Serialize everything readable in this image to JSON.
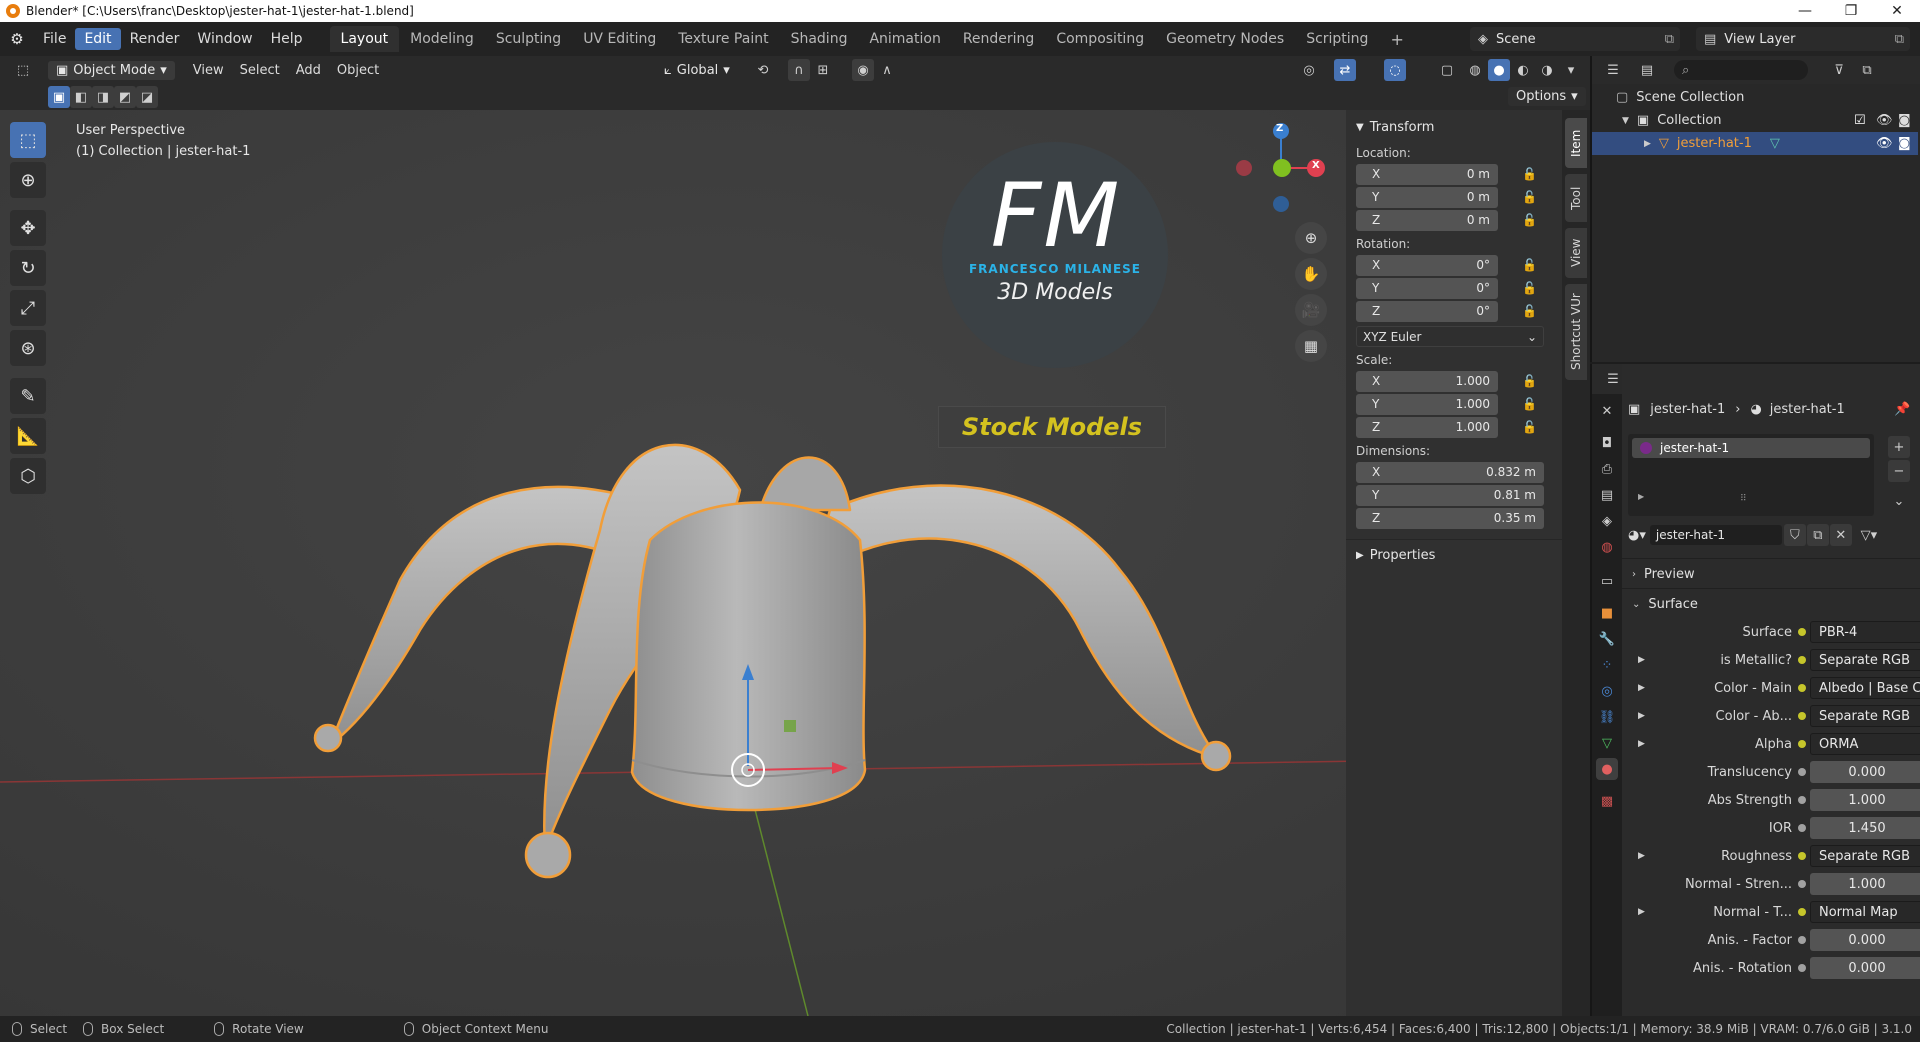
{
  "window": {
    "title": "Blender* [C:\\Users\\franc\\Desktop\\jester-hat-1\\jester-hat-1.blend]",
    "controls": [
      "—",
      "❐",
      "✕"
    ]
  },
  "menu": {
    "items": [
      "File",
      "Edit",
      "Render",
      "Window",
      "Help"
    ],
    "active": "Edit"
  },
  "workspaces": {
    "tabs": [
      "Layout",
      "Modeling",
      "Sculpting",
      "UV Editing",
      "Texture Paint",
      "Shading",
      "Animation",
      "Rendering",
      "Compositing",
      "Geometry Nodes",
      "Scripting"
    ],
    "active": "Layout",
    "add": "+"
  },
  "scene": {
    "name": "Scene"
  },
  "view_layer": {
    "name": "View Layer"
  },
  "viewport_header": {
    "mode": "Object Mode",
    "menus": [
      "View",
      "Select",
      "Add",
      "Object"
    ],
    "transform_orientation": "Global",
    "options": "Options"
  },
  "viewport": {
    "perspective": "User Perspective",
    "collection_info": "(1) Collection | jester-hat-1",
    "gizmo": {
      "z": "Z",
      "x": "X",
      "y": "Y"
    },
    "watermark": {
      "initials": "FM",
      "name": "FRANCESCO MILANESE",
      "tagline": "3D Models",
      "banner": "Stock Models"
    }
  },
  "sidebar": {
    "tabs": [
      "Item",
      "Tool",
      "View",
      "Shortcut VUr"
    ],
    "active_tab": "Item",
    "transform_header": "Transform",
    "location": {
      "label": "Location:",
      "x": "0 m",
      "y": "0 m",
      "z": "0 m"
    },
    "rotation": {
      "label": "Rotation:",
      "x": "0°",
      "y": "0°",
      "z": "0°",
      "mode": "XYZ Euler"
    },
    "scale": {
      "label": "Scale:",
      "x": "1.000",
      "y": "1.000",
      "z": "1.000"
    },
    "dimensions": {
      "label": "Dimensions:",
      "x": "0.832 m",
      "y": "0.81 m",
      "z": "0.35 m"
    },
    "axis": {
      "x": "X",
      "y": "Y",
      "z": "Z"
    },
    "properties_header": "Properties"
  },
  "outliner": {
    "scene_collection": "Scene Collection",
    "collection": "Collection",
    "object": "jester-hat-1"
  },
  "properties": {
    "breadcrumb": {
      "object": "jester-hat-1",
      "material": "jester-hat-1"
    },
    "material_slot": "jester-hat-1",
    "material_name": "jester-hat-1",
    "preview": "Preview",
    "surface_header": "Surface",
    "rows": [
      {
        "label": "Surface",
        "value": "PBR-4",
        "socket": "#c6c62b",
        "kind": "link",
        "expand": false
      },
      {
        "label": "is Metallic?",
        "value": "Separate RGB",
        "socket": "#c6c62b",
        "kind": "link",
        "expand": true
      },
      {
        "label": "Color - Main",
        "value": "Albedo | Base Color",
        "socket": "#c6c62b",
        "kind": "link",
        "expand": true
      },
      {
        "label": "Color - Ab...",
        "value": "Separate RGB",
        "socket": "#c6c62b",
        "kind": "link",
        "expand": true
      },
      {
        "label": "Alpha",
        "value": "ORMA",
        "socket": "#c6c62b",
        "kind": "link",
        "expand": true
      },
      {
        "label": "Translucency",
        "value": "0.000",
        "socket": "#a1a1a1",
        "kind": "num",
        "expand": false
      },
      {
        "label": "Abs Strength",
        "value": "1.000",
        "socket": "#a1a1a1",
        "kind": "num",
        "expand": false
      },
      {
        "label": "IOR",
        "value": "1.450",
        "socket": "#a1a1a1",
        "kind": "num",
        "expand": false
      },
      {
        "label": "Roughness",
        "value": "Separate RGB",
        "socket": "#c6c62b",
        "kind": "link",
        "expand": true
      },
      {
        "label": "Normal - Stren...",
        "value": "1.000",
        "socket": "#a1a1a1",
        "kind": "num",
        "expand": false
      },
      {
        "label": "Normal - T...",
        "value": "Normal Map",
        "socket": "#c6c62b",
        "kind": "link",
        "expand": true
      },
      {
        "label": "Anis. - Factor",
        "value": "0.000",
        "socket": "#a1a1a1",
        "kind": "num",
        "expand": false
      },
      {
        "label": "Anis. - Rotation",
        "value": "0.000",
        "socket": "#a1a1a1",
        "kind": "num",
        "expand": false
      }
    ]
  },
  "statusbar": {
    "select": "Select",
    "box_select": "Box Select",
    "rotate_view": "Rotate View",
    "context_menu": "Object Context Menu",
    "stats": "Collection | jester-hat-1 | Verts:6,454 | Faces:6,400 | Tris:12,800 | Objects:1/1 | Memory: 38.9 MiB | VRAM: 0.7/6.0 GiB | 3.1.0"
  },
  "colors": {
    "accent": "#4772b3",
    "selection_outline": "#f19e39",
    "gizmo_x": "#e04050",
    "gizmo_y": "#80c020",
    "gizmo_z": "#3a7fd0",
    "watermark_banner_text": "#d4c21f",
    "watermark_fm": "#2bb3e8"
  }
}
